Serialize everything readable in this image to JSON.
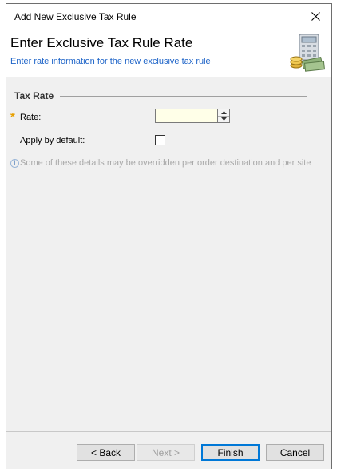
{
  "window": {
    "title": "Add New Exclusive Tax Rule"
  },
  "header": {
    "title": "Enter Exclusive Tax Rule Rate",
    "subtitle": "Enter rate information for the new exclusive tax rule",
    "icon": "calculator-money-icon"
  },
  "section": {
    "title": "Tax Rate"
  },
  "form": {
    "rate_label": "Rate:",
    "rate_value": "",
    "apply_label": "Apply by default:",
    "apply_checked": false
  },
  "info": {
    "text": "Some of these details may be overridden per order destination and per site"
  },
  "buttons": {
    "back": "< Back",
    "next": "Next >",
    "finish": "Finish",
    "cancel": "Cancel"
  },
  "colors": {
    "subtitle": "#1e64c8",
    "required": "#e8a000",
    "input_bg": "#ffffe8",
    "primary_border": "#0078d7"
  }
}
